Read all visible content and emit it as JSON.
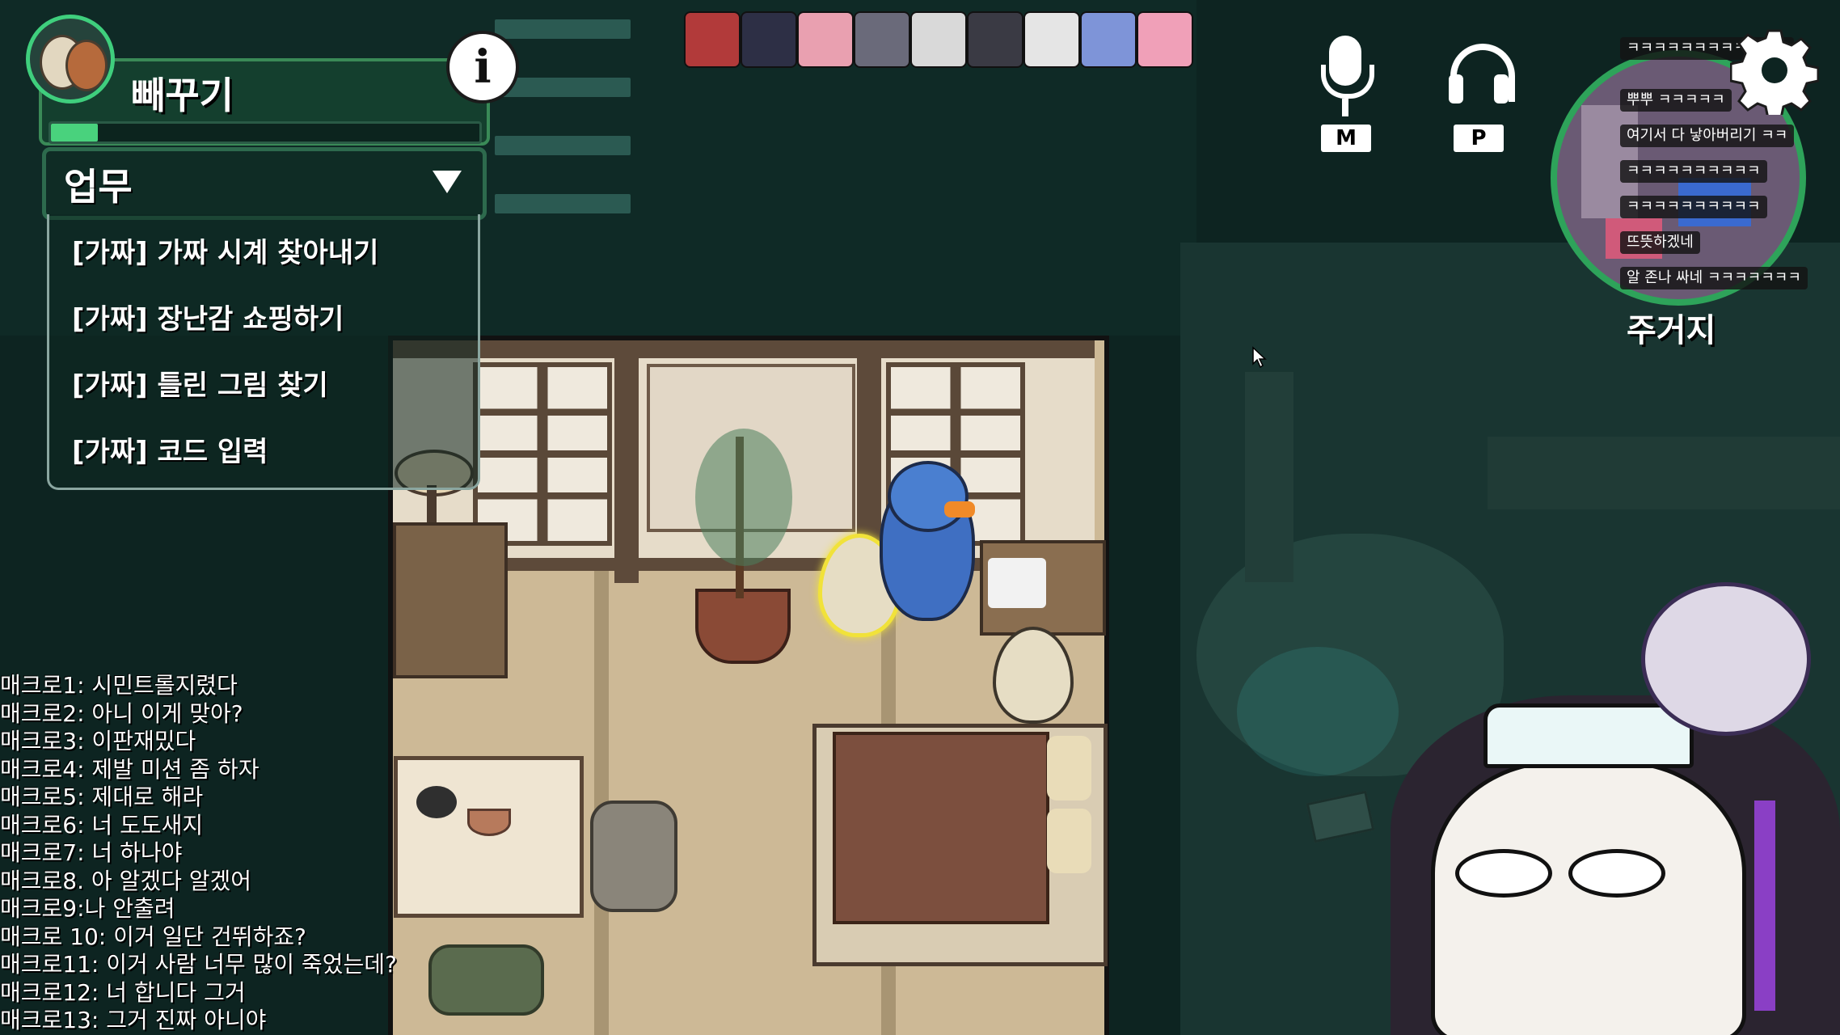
{
  "hud": {
    "role_name": "빼꾸기",
    "task_header": "업무",
    "tasks": [
      "[가짜] 가짜 시계 찾아내기",
      "[가짜] 장난감 쇼핑하기",
      "[가짜] 틀린 그림 찾기",
      "[가짜] 코드 입력"
    ],
    "task_progress": 0.11,
    "mic_key": "M",
    "headphone_key": "P",
    "location": "주거지",
    "colors": {
      "accent": "#3fcf7d",
      "panel": "#143f2e"
    }
  },
  "players": [
    {
      "color": "#b23a3a"
    },
    {
      "color": "#2d2f45"
    },
    {
      "color": "#e9a0b0"
    },
    {
      "color": "#6a6a7a"
    },
    {
      "color": "#d9d9d9"
    },
    {
      "color": "#3a3a44"
    },
    {
      "color": "#e5e5e5"
    },
    {
      "color": "#7e94d8"
    },
    {
      "color": "#f0a0b8"
    }
  ],
  "minimap_chat": [
    "ㅋㅋㅋㅋㅋㅋㅋㅋㅋㅋㅋㅋ",
    "뿌뿌 ㅋㅋㅋㅋㅋ",
    "여기서 다 낳아버리기 ㅋㅋ",
    "ㅋㅋㅋㅋㅋㅋㅋㅋㅋㅋ",
    "ㅋㅋㅋㅋㅋㅋㅋㅋㅋㅋ",
    "뜨뜻하겠네",
    "알 존나 싸네 ㅋㅋㅋㅋㅋㅋㅋ"
  ],
  "chat": [
    "매크로1: 시민트롤지렸다",
    "매크로2: 아니 이게 맞아?",
    "매크로3: 이판재밌다",
    "매크로4: 제발 미션 좀 하자",
    "매크로5: 제대로 해라",
    "매크로6: 너 도도새지",
    "매크로7: 너 하나야",
    "매크로8. 아 알겠다 알겠어",
    "매크로9:나 안출려",
    "매크로 10: 이거 일단 건뛰하죠?",
    "매크로11: 이거 사람 너무 많이 죽었는데?",
    "매크로12: 너 합니다 그거",
    "매크로13: 그거 진짜 아니야"
  ],
  "icons": {
    "info": "info-icon",
    "settings": "gear-icon",
    "mic": "microphone-icon",
    "headphones": "headphones-icon",
    "dropdown": "dropdown-arrow-icon",
    "cursor": "mouse-cursor-icon"
  }
}
